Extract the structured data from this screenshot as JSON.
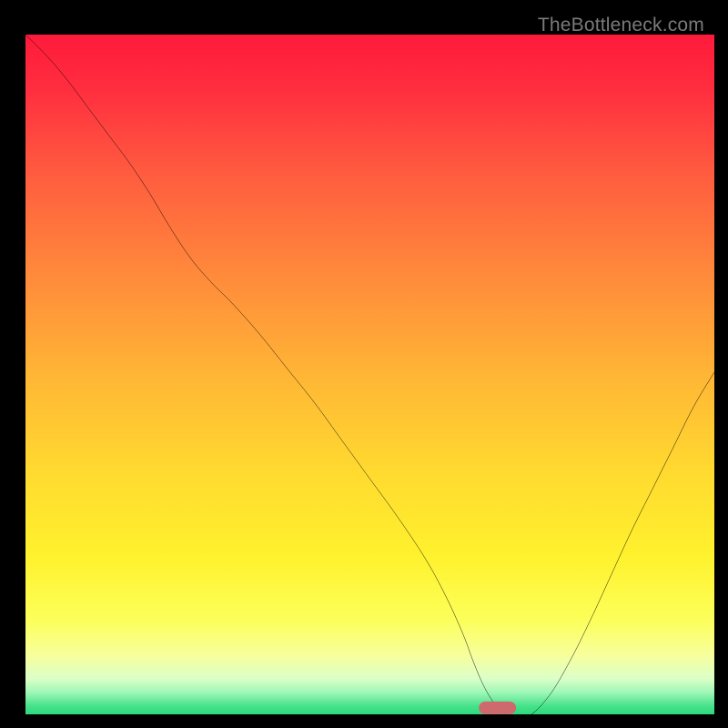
{
  "watermark": {
    "text": "TheBottleneck.com"
  },
  "chart_data": {
    "type": "line",
    "title": "",
    "xlabel": "",
    "ylabel": "",
    "xlim": [
      0,
      100
    ],
    "ylim": [
      0,
      100
    ],
    "grid": false,
    "legend": false,
    "annotations": [],
    "background_gradient": {
      "orientation": "vertical",
      "stops": [
        {
          "pos": 0.0,
          "color": "#ff1a3b"
        },
        {
          "pos": 0.08,
          "color": "#ff2e3f"
        },
        {
          "pos": 0.2,
          "color": "#ff5b3f"
        },
        {
          "pos": 0.35,
          "color": "#ff8a3b"
        },
        {
          "pos": 0.5,
          "color": "#ffb735"
        },
        {
          "pos": 0.64,
          "color": "#ffdb2f"
        },
        {
          "pos": 0.76,
          "color": "#fff22e"
        },
        {
          "pos": 0.85,
          "color": "#fcff5a"
        },
        {
          "pos": 0.9,
          "color": "#f7ff9b"
        },
        {
          "pos": 0.935,
          "color": "#dcffc8"
        },
        {
          "pos": 0.955,
          "color": "#9ef7b6"
        },
        {
          "pos": 0.975,
          "color": "#46e28a"
        },
        {
          "pos": 1.0,
          "color": "#12cf6d"
        }
      ]
    },
    "series": [
      {
        "name": "bottleneck-curve",
        "color": "#000000",
        "x": [
          0,
          3,
          6,
          9,
          12,
          15,
          18,
          21,
          24,
          27,
          30,
          34,
          38,
          42,
          46,
          50,
          54,
          58,
          61,
          63.5,
          65,
          66.5,
          68,
          69.5,
          71,
          73,
          76,
          79,
          82,
          85,
          88,
          91,
          94,
          97,
          100
        ],
        "y": [
          100,
          97,
          93.5,
          89.5,
          85.5,
          81.5,
          77,
          72,
          67.5,
          64,
          61,
          56.5,
          51.5,
          46.5,
          41,
          35.5,
          30,
          24,
          18.5,
          13,
          9,
          5.5,
          3,
          1.5,
          1,
          1,
          4,
          9,
          15,
          21.5,
          28,
          34,
          40,
          46,
          51
        ]
      }
    ],
    "marker": {
      "shape": "pill",
      "color": "#ce6a6d",
      "x": 68.5,
      "y": 0.9,
      "width_pct": 5.5,
      "height_pct": 1.9
    }
  }
}
